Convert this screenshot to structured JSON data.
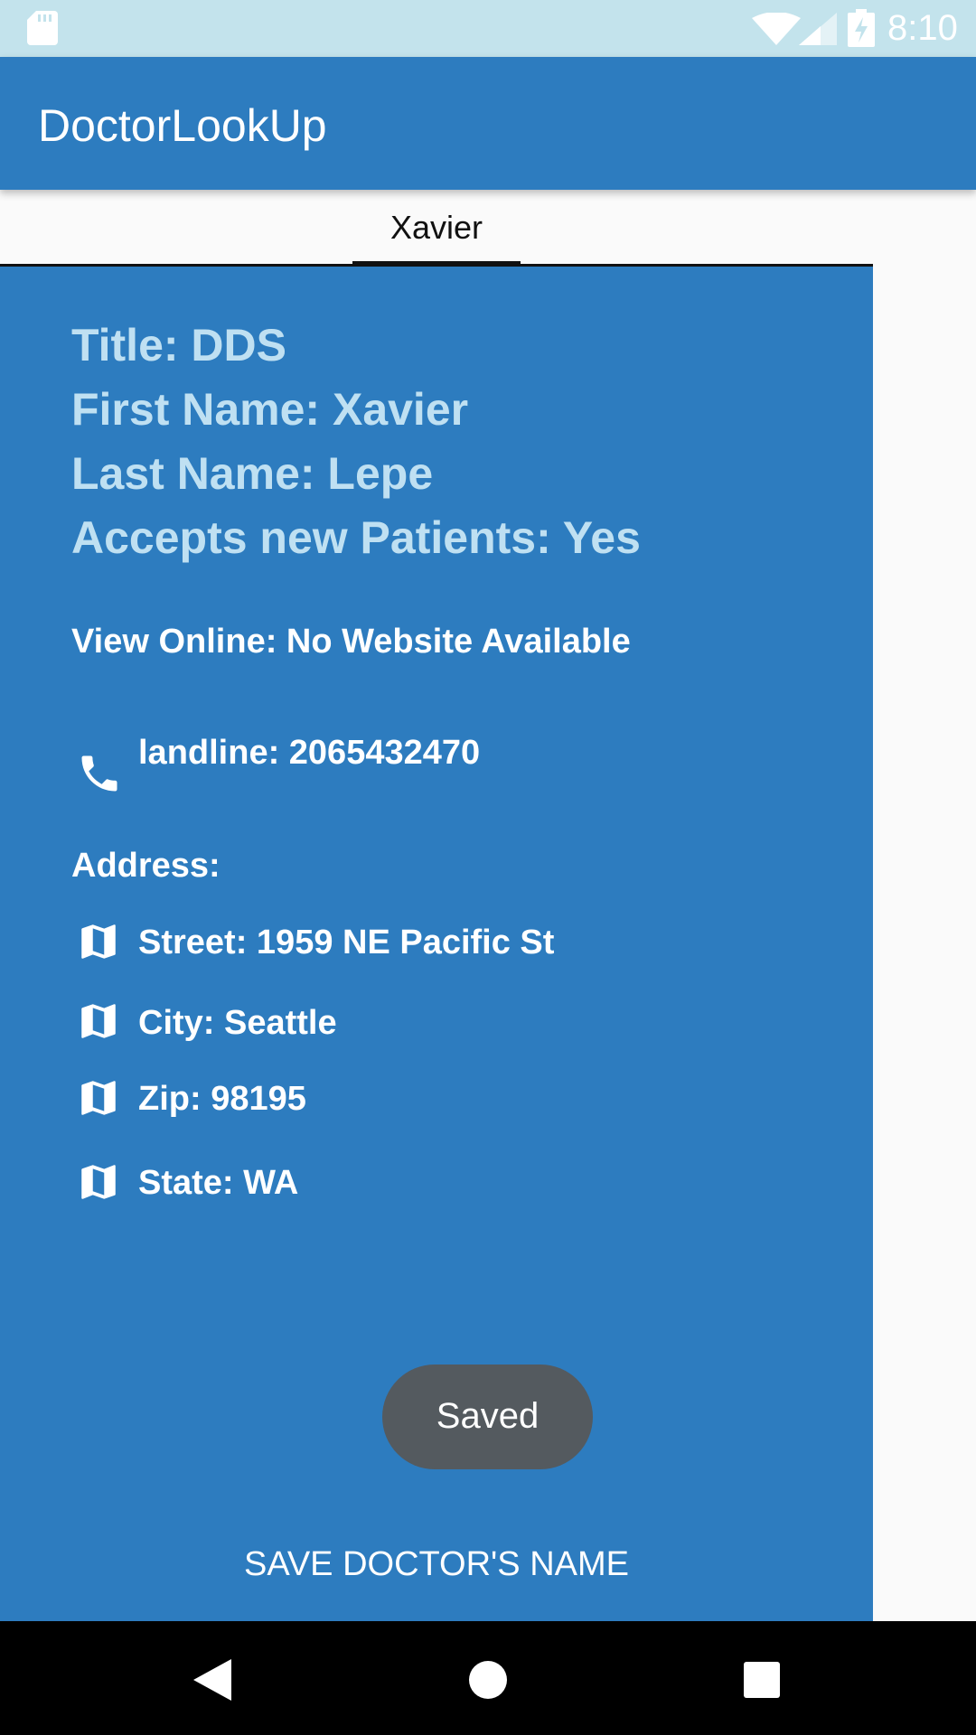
{
  "status_bar": {
    "time": "8:10",
    "icons": [
      "sd-card-icon",
      "wifi-icon",
      "cell-signal-icon",
      "battery-charging-icon"
    ]
  },
  "app_bar": {
    "title": "DoctorLookUp"
  },
  "tabs": [
    {
      "label": "Xavier",
      "selected": true
    }
  ],
  "doctor": {
    "title_line": "Title: DDS",
    "first_name_line": "First Name: Xavier",
    "last_name_line": "Last Name: Lepe",
    "accepts_line": "Accepts new Patients: Yes",
    "website_line": "View Online: No Website Available",
    "phone_line": "landline: 2065432470",
    "address_heading": "Address:",
    "street_line": "Street: 1959 NE Pacific St",
    "city_line": "City: Seattle",
    "zip_line": "Zip: 98195",
    "state_line": "State: WA"
  },
  "icons": {
    "phone": "phone-icon",
    "address": "map-icon",
    "nav": [
      "back-icon",
      "home-icon",
      "recents-icon"
    ]
  },
  "toast": {
    "text": "Saved"
  },
  "save_button": {
    "label": "SAVE DOCTOR'S NAME"
  },
  "colors": {
    "app_bar": "#2d7cbf",
    "status_bar": "#c3e3ec",
    "heading_text": "#bfe0f2",
    "toast": "#545a5f",
    "nav_bar": "#000000"
  }
}
